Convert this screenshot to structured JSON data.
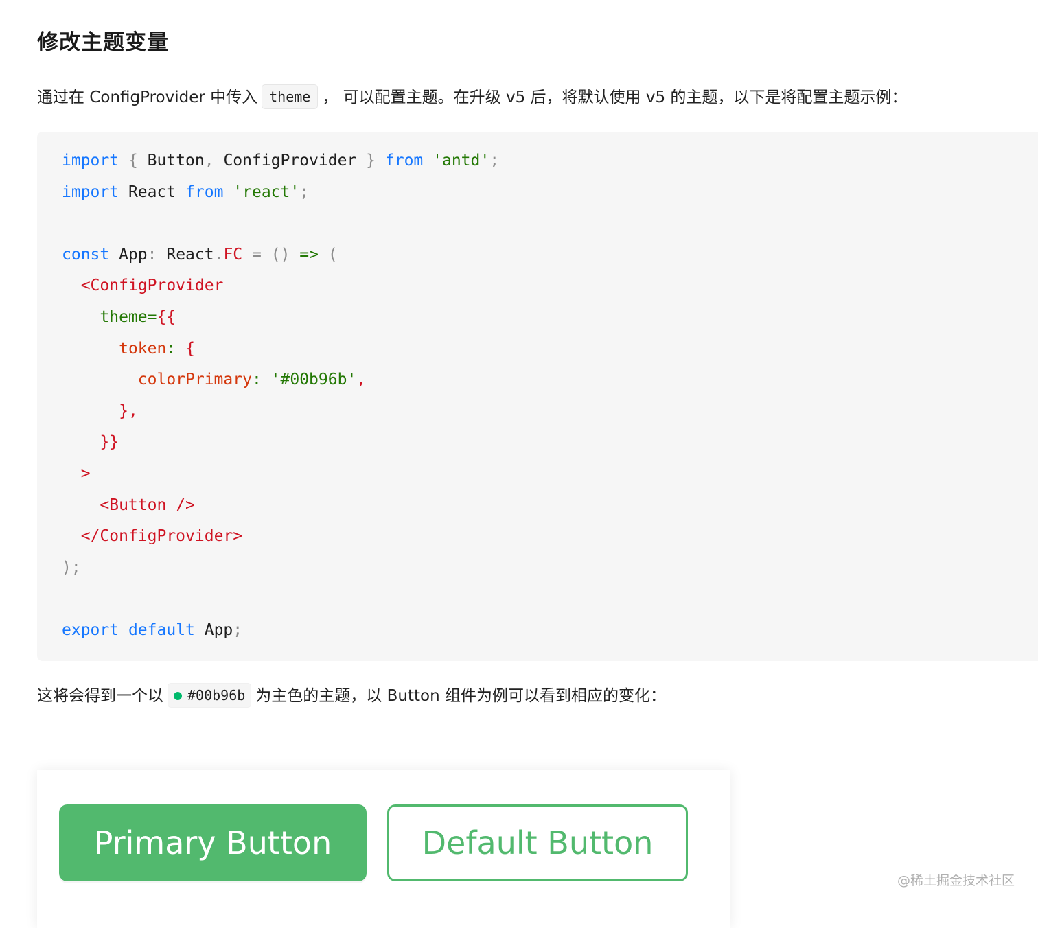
{
  "heading": "修改主题变量",
  "intro": {
    "before": "通过在 ConfigProvider 中传入",
    "code": "theme",
    "after": "， 可以配置主题。在升级 v5 后，将默认使用 v5 的主题，以下是将配置主题示例："
  },
  "code_lines": [
    [
      {
        "t": "import",
        "c": "kw"
      },
      {
        "t": " ",
        "c": "id"
      },
      {
        "t": "{",
        "c": "pun"
      },
      {
        "t": " Button",
        "c": "id"
      },
      {
        "t": ",",
        "c": "pun"
      },
      {
        "t": " ConfigProvider ",
        "c": "id"
      },
      {
        "t": "}",
        "c": "pun"
      },
      {
        "t": " ",
        "c": "id"
      },
      {
        "t": "from",
        "c": "kw"
      },
      {
        "t": " ",
        "c": "id"
      },
      {
        "t": "'antd'",
        "c": "str"
      },
      {
        "t": ";",
        "c": "pun"
      }
    ],
    [
      {
        "t": "import",
        "c": "kw"
      },
      {
        "t": " React ",
        "c": "id"
      },
      {
        "t": "from",
        "c": "kw"
      },
      {
        "t": " ",
        "c": "id"
      },
      {
        "t": "'react'",
        "c": "str"
      },
      {
        "t": ";",
        "c": "pun"
      }
    ],
    [],
    [
      {
        "t": "const",
        "c": "kw"
      },
      {
        "t": " App",
        "c": "id"
      },
      {
        "t": ":",
        "c": "pun"
      },
      {
        "t": " React",
        "c": "id"
      },
      {
        "t": ".",
        "c": "pun"
      },
      {
        "t": "FC",
        "c": "tag"
      },
      {
        "t": " ",
        "c": "id"
      },
      {
        "t": "=",
        "c": "pun"
      },
      {
        "t": " ",
        "c": "id"
      },
      {
        "t": "()",
        "c": "pun"
      },
      {
        "t": " ",
        "c": "id"
      },
      {
        "t": "=>",
        "c": "attr"
      },
      {
        "t": " ",
        "c": "id"
      },
      {
        "t": "(",
        "c": "pun"
      }
    ],
    [
      {
        "t": "  ",
        "c": "id"
      },
      {
        "t": "<ConfigProvider",
        "c": "tag"
      }
    ],
    [
      {
        "t": "    ",
        "c": "id"
      },
      {
        "t": "theme=",
        "c": "attr"
      },
      {
        "t": "{{",
        "c": "tag"
      }
    ],
    [
      {
        "t": "      ",
        "c": "id"
      },
      {
        "t": "token",
        "c": "prop"
      },
      {
        "t": ":",
        "c": "attr"
      },
      {
        "t": " ",
        "c": "id"
      },
      {
        "t": "{",
        "c": "tag"
      }
    ],
    [
      {
        "t": "        ",
        "c": "id"
      },
      {
        "t": "colorPrimary",
        "c": "prop"
      },
      {
        "t": ":",
        "c": "attr"
      },
      {
        "t": " ",
        "c": "id"
      },
      {
        "t": "'#00b96b'",
        "c": "str"
      },
      {
        "t": ",",
        "c": "tag"
      }
    ],
    [
      {
        "t": "      ",
        "c": "id"
      },
      {
        "t": "},",
        "c": "tag"
      }
    ],
    [
      {
        "t": "    ",
        "c": "id"
      },
      {
        "t": "}}",
        "c": "tag"
      }
    ],
    [
      {
        "t": "  ",
        "c": "id"
      },
      {
        "t": ">",
        "c": "tag"
      }
    ],
    [
      {
        "t": "    ",
        "c": "id"
      },
      {
        "t": "<Button />",
        "c": "tag"
      }
    ],
    [
      {
        "t": "  ",
        "c": "id"
      },
      {
        "t": "</ConfigProvider>",
        "c": "tag"
      }
    ],
    [
      {
        "t": ");",
        "c": "pun"
      }
    ],
    [],
    [
      {
        "t": "export",
        "c": "kw"
      },
      {
        "t": " ",
        "c": "id"
      },
      {
        "t": "default",
        "c": "kw"
      },
      {
        "t": " App",
        "c": "id"
      },
      {
        "t": ";",
        "c": "pun"
      }
    ]
  ],
  "result": {
    "before": "这将会得到一个以",
    "color_code": "#00b96b",
    "after": "为主色的主题，以 Button 组件为例可以看到相应的变化："
  },
  "demo": {
    "primary_label": "Primary Button",
    "default_label": "Default Button",
    "primary_color": "#52b96e",
    "swatch_color": "#00b96b"
  },
  "watermark": "@稀土掘金技术社区"
}
